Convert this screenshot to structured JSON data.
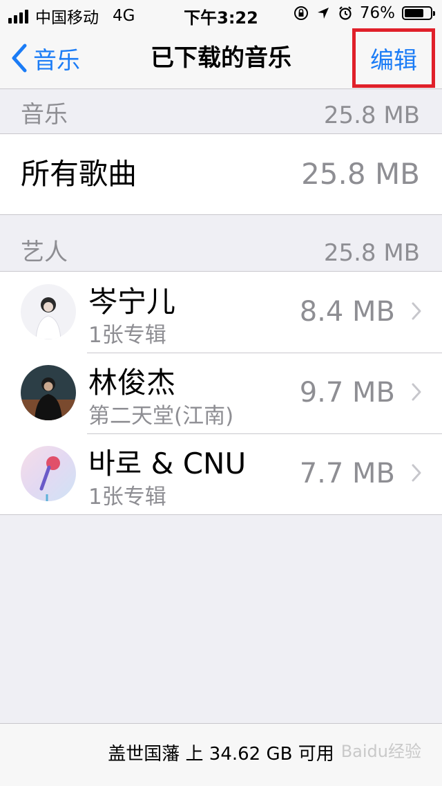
{
  "status_bar": {
    "carrier": "中国移动",
    "network": "4G",
    "time": "下午3:22",
    "battery": "76%",
    "battery_level": 0.76
  },
  "nav": {
    "back_label": "音乐",
    "title": "已下载的音乐",
    "edit_label": "编辑",
    "edit_highlight_color": "#e0202a",
    "accent_color": "#1b7cf6"
  },
  "music_section": {
    "header": "音乐",
    "total": "25.8 MB",
    "all_songs_label": "所有歌曲",
    "all_songs_size": "25.8 MB"
  },
  "artist_section": {
    "header": "艺人",
    "total": "25.8 MB",
    "artists": [
      {
        "name": "岑宁儿",
        "subtitle": "1张专辑",
        "size": "8.4 MB"
      },
      {
        "name": "林俊杰",
        "subtitle": "第二天堂(江南)",
        "size": "9.7 MB"
      },
      {
        "name": "바로 & CNU",
        "subtitle": "1张专辑",
        "size": "7.7 MB"
      }
    ]
  },
  "footer": {
    "storage_text": "盖世国藩 上 34.62 GB 可用",
    "watermark": "Baidu经验"
  }
}
